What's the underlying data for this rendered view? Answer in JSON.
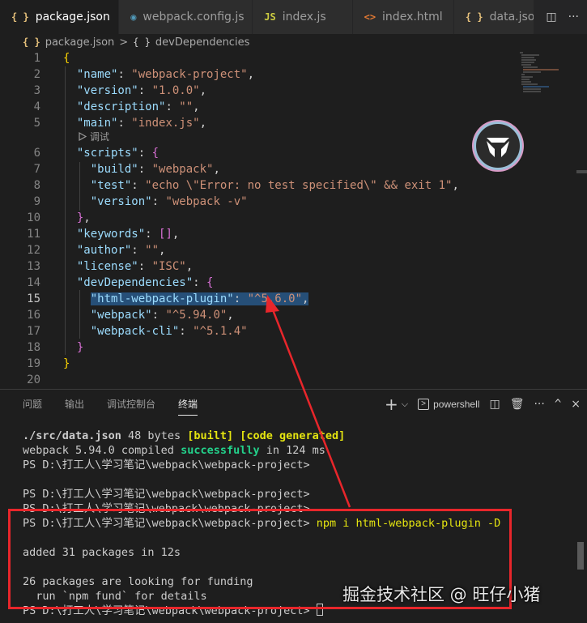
{
  "tabs": [
    {
      "icon": "{ }",
      "label": "package.json",
      "active": true,
      "close": "×"
    },
    {
      "icon": "◉",
      "label": "webpack.config.js",
      "active": false
    },
    {
      "icon": "JS",
      "label": "index.js",
      "active": false
    },
    {
      "icon": "<>",
      "label": "index.html",
      "active": false
    },
    {
      "icon": "{ }",
      "label": "data.json",
      "active": false
    }
  ],
  "breadcrumb": {
    "file": "package.json",
    "section": "devDependencies",
    "icon": "{ }",
    "section_icon": "{ }",
    "separator": ">"
  },
  "editor": {
    "current_line": 15,
    "codelens": "调试",
    "line_numbers": [
      "1",
      "2",
      "3",
      "4",
      "5",
      "6",
      "7",
      "8",
      "9",
      "10",
      "11",
      "12",
      "13",
      "14",
      "15",
      "16",
      "17",
      "18",
      "19",
      "20"
    ],
    "lines": {
      "l1": {
        "open": "{"
      },
      "l2": {
        "key": "\"name\"",
        "value": "\"webpack-project\"",
        "tail": ","
      },
      "l3": {
        "key": "\"version\"",
        "value": "\"1.0.0\"",
        "tail": ","
      },
      "l4": {
        "key": "\"description\"",
        "value": "\"\"",
        "tail": ","
      },
      "l5": {
        "key": "\"main\"",
        "value": "\"index.js\"",
        "tail": ","
      },
      "l6": {
        "key": "\"scripts\"",
        "open": "{"
      },
      "l7": {
        "key": "\"build\"",
        "value": "\"webpack\"",
        "tail": ","
      },
      "l8": {
        "key": "\"test\"",
        "value": "\"echo \\\"Error: no test specified\\\" && exit 1\"",
        "tail": ","
      },
      "l9": {
        "key": "\"version\"",
        "value": "\"webpack -v\""
      },
      "l10": {
        "close": "}",
        "tail": ","
      },
      "l11": {
        "key": "\"keywords\"",
        "value": "[]",
        "tail": ","
      },
      "l12": {
        "key": "\"author\"",
        "value": "\"\"",
        "tail": ","
      },
      "l13": {
        "key": "\"license\"",
        "value": "\"ISC\"",
        "tail": ","
      },
      "l14": {
        "key": "\"devDependencies\"",
        "open": "{"
      },
      "l15": {
        "key": "\"html-webpack-plugin\"",
        "value": "\"^5.6.0\"",
        "tail": ","
      },
      "l16": {
        "key": "\"webpack\"",
        "value": "\"^5.94.0\"",
        "tail": ","
      },
      "l17": {
        "key": "\"webpack-cli\"",
        "value": "\"^5.1.4\""
      },
      "l18": {
        "close": "}"
      },
      "l19": {
        "close": "}"
      }
    }
  },
  "panel": {
    "tabs": [
      "问题",
      "输出",
      "调试控制台",
      "终端"
    ],
    "active_tab": "终端",
    "shell": "powershell",
    "actions": {
      "add": "+",
      "dropdown": "⌵",
      "split": "◫",
      "trash": "🗑",
      "more": "···",
      "maximize": "^",
      "close": "×"
    }
  },
  "terminal": {
    "l1": {
      "file": "./src/data.json",
      "rest": " 48 bytes ",
      "built": "[built]",
      "gen": "[code generated]"
    },
    "l2": {
      "pre": "webpack 5.94.0 compiled ",
      "ok": "successfully",
      "post": " in 124 ms"
    },
    "prompt": "PS D:\\打工人\\学习笔记\\webpack\\webpack-project>",
    "command": "npm i html-webpack-plugin -D",
    "added": "added 31 packages in 12s",
    "funding1": "26 packages are looking for funding",
    "funding2": "  run `npm fund` for details"
  },
  "watermark": "掘金技术社区 @ 旺仔小猪",
  "colors": {
    "annotation_red": "#e8262b",
    "selection": "#264f78"
  }
}
